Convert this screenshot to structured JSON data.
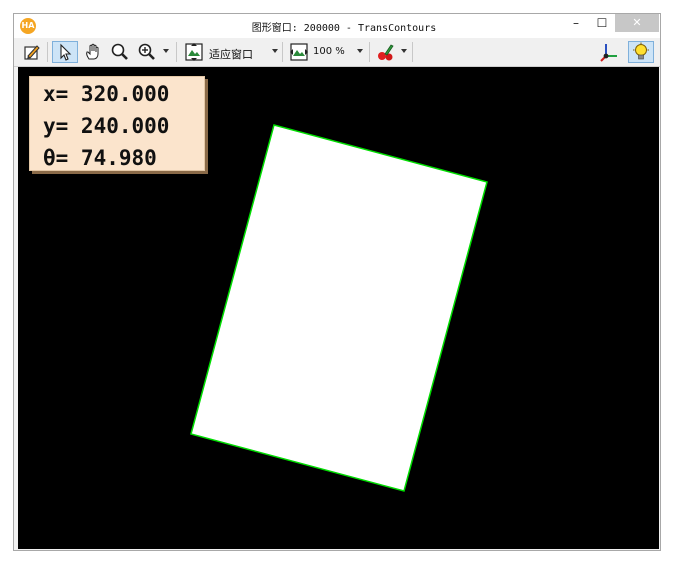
{
  "window": {
    "title": "图形窗口: 200000 - TransContours",
    "app_icon_text": "HA",
    "minimize_glyph": "–",
    "maximize_glyph": "☐",
    "close_glyph": "✕"
  },
  "toolbar": {
    "items": [
      {
        "name": "edit-icon",
        "active": false
      },
      {
        "name": "pointer-icon",
        "active": true
      },
      {
        "name": "hand-pan-icon",
        "active": false
      },
      {
        "name": "magnifier-icon",
        "active": false
      },
      {
        "name": "zoom-in-icon",
        "active": false
      },
      {
        "name": "fit-window-icon",
        "active": false
      },
      {
        "name": "zoom-percent-icon",
        "active": false
      },
      {
        "name": "color-paint-icon",
        "active": false
      },
      {
        "name": "axes-icon",
        "active": false
      },
      {
        "name": "lightbulb-icon",
        "active": true
      }
    ],
    "fit_window_label": "适应窗口",
    "zoom_label": "100 %"
  },
  "info": {
    "x_line": "x= 320.000",
    "y_line": "y= 240.000",
    "theta_line": "θ= 74.980"
  },
  "colors": {
    "canvas_bg": "#000000",
    "shape_fill": "#ffffff",
    "contour": "#00dd00",
    "info_bg": "#fbe4cc",
    "active_button": "#cde4f7"
  }
}
